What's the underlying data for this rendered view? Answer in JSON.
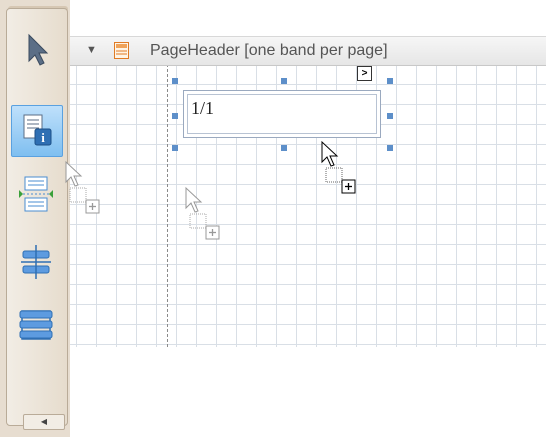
{
  "band": {
    "collapse_glyph": "▼",
    "label": "PageHeader [one band per page]"
  },
  "label_control": {
    "text": "1/1",
    "smart_tag_glyph": ">"
  },
  "toolbox": {
    "items": [
      {
        "name": "pointer-icon"
      },
      {
        "name": "page-info-icon",
        "selected": true
      },
      {
        "name": "page-break-icon"
      },
      {
        "name": "line-icon"
      },
      {
        "name": "cross-band-box-icon"
      }
    ],
    "scroll_glyph": "◀"
  },
  "colors": {
    "accent": "#4a90d9",
    "toolbox_bg": "#e7ddd0",
    "grid_line": "#d9dfe6",
    "band_header_bg": "#eeeeee"
  }
}
